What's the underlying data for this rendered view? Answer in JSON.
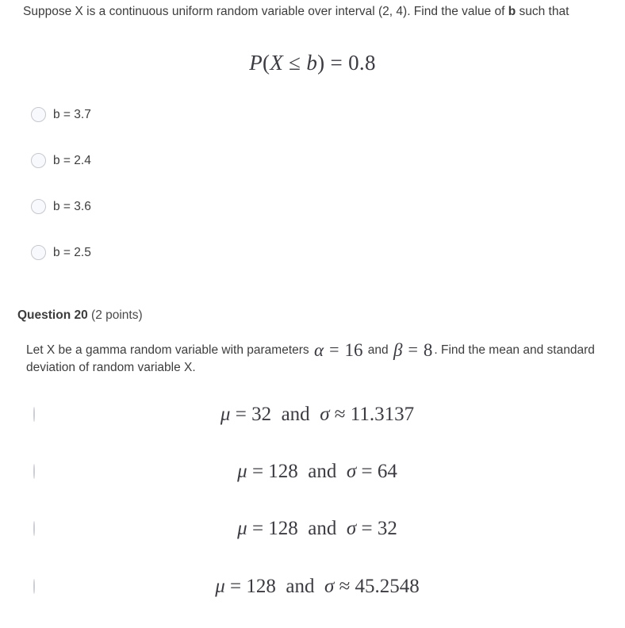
{
  "question19": {
    "prompt_line1": "Suppose X is a continuous uniform random variable over interval (2, 4). Find the",
    "prompt_line2_pre": "value of ",
    "prompt_line2_bold": "b",
    "prompt_line2_post": " such that",
    "display_equation": {
      "p": "P",
      "open_paren": "(",
      "x": "X",
      "leq": "≤",
      "b": "b",
      "close_paren": ")",
      "equals": "=",
      "value": "0.8",
      "full": "P(X ≤ b) = 0.8"
    },
    "options": [
      {
        "label": "b = 3.7",
        "selected": false
      },
      {
        "label": "b = 2.4",
        "selected": false
      },
      {
        "label": "b = 3.6",
        "selected": false
      },
      {
        "label": "b = 2.5",
        "selected": false
      }
    ]
  },
  "question20": {
    "heading_number": "Question 20",
    "heading_points": "(2 points)",
    "body_pre": "Let X be a gamma random variable with parameters ",
    "body_alpha": "α",
    "body_alpha_eq": "=",
    "body_alpha_value": "16",
    "body_and": " and ",
    "body_beta": "β",
    "body_beta_eq": "=",
    "body_beta_value": "8",
    "body_post": ". Find the mean and standard deviation of random variable X.",
    "options": [
      {
        "mu_symbol": "μ",
        "mu_rel": "=",
        "mu_value": "32",
        "conj": "and",
        "sigma_symbol": "σ",
        "sigma_rel": "≈",
        "sigma_value": "11.3137",
        "full": "μ = 32  and  σ ≈ 11.3137",
        "selected": false
      },
      {
        "mu_symbol": "μ",
        "mu_rel": "=",
        "mu_value": "128",
        "conj": "and",
        "sigma_symbol": "σ",
        "sigma_rel": "=",
        "sigma_value": "64",
        "full": "μ = 128  and  σ = 64",
        "selected": false
      },
      {
        "mu_symbol": "μ",
        "mu_rel": "=",
        "mu_value": "128",
        "conj": "and",
        "sigma_symbol": "σ",
        "sigma_rel": "=",
        "sigma_value": "32",
        "full": "μ = 128  and  σ = 32",
        "selected": false
      },
      {
        "mu_symbol": "μ",
        "mu_rel": "=",
        "mu_value": "128",
        "conj": "and",
        "sigma_symbol": "σ",
        "sigma_rel": "≈",
        "sigma_value": "45.2548",
        "full": "μ = 128  and  σ ≈ 45.2548",
        "selected": false
      }
    ]
  },
  "colors": {
    "background": "#ffffff",
    "text": "#3d3d3d",
    "math_text": "#3b3b42",
    "radio_border": "#c6c8ce",
    "radio_fill": "#f8f9fc"
  }
}
